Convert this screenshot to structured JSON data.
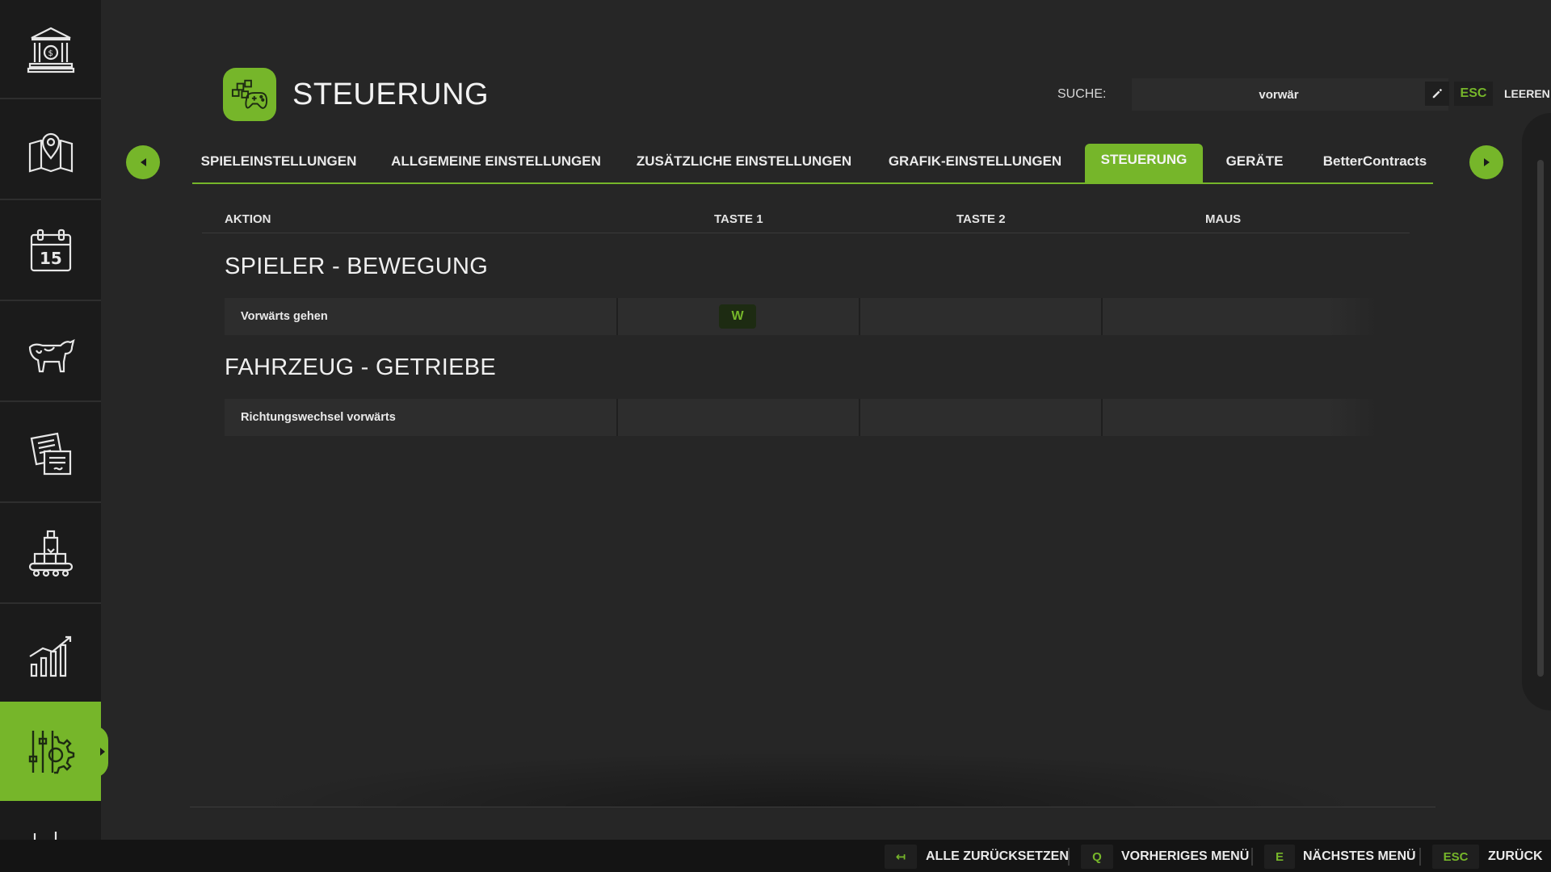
{
  "sidebar": {
    "items": [
      {
        "name": "bank-icon"
      },
      {
        "name": "map-icon"
      },
      {
        "name": "calendar-icon",
        "calendar_day": "15"
      },
      {
        "name": "animals-icon"
      },
      {
        "name": "contracts-icon"
      },
      {
        "name": "production-icon"
      },
      {
        "name": "statistics-icon"
      },
      {
        "name": "settings-icon",
        "active": true
      }
    ]
  },
  "header": {
    "title": "STEUERUNG",
    "search_label": "SUCHE:",
    "search_value": "vorwär",
    "esc_key": "ESC",
    "clear_label": "LEEREN"
  },
  "tabs": [
    {
      "label": "SPIELEINSTELLUNGEN"
    },
    {
      "label": "ALLGEMEINE EINSTELLUNGEN"
    },
    {
      "label": "ZUSÄTZLICHE EINSTELLUNGEN"
    },
    {
      "label": "GRAFIK-EINSTELLUNGEN"
    },
    {
      "label": "STEUERUNG",
      "active": true
    },
    {
      "label": "GERÄTE"
    },
    {
      "label": "BetterContracts"
    }
  ],
  "table": {
    "columns": [
      "AKTION",
      "TASTE 1",
      "TASTE 2",
      "MAUS"
    ],
    "sections": [
      {
        "title": "SPIELER - BEWEGUNG",
        "rows": [
          {
            "action": "Vorwärts gehen",
            "key1": "W",
            "key2": "",
            "mouse": ""
          }
        ]
      },
      {
        "title": "FAHRZEUG - GETRIEBE",
        "rows": [
          {
            "action": "Richtungswechsel vorwärts",
            "key1": "",
            "key2": "",
            "mouse": ""
          }
        ]
      }
    ]
  },
  "footer": {
    "actions": [
      {
        "key": "↤",
        "label": "ALLE ZURÜCKSETZEN"
      },
      {
        "key": "Q",
        "label": "VORHERIGES MENÜ"
      },
      {
        "key": "E",
        "label": "NÄCHSTES MENÜ"
      },
      {
        "key": "ESC",
        "label": "ZURÜCK"
      }
    ]
  },
  "colors": {
    "accent": "#76b62a",
    "background": "#262626",
    "sidebar": "#1b1b1b"
  }
}
